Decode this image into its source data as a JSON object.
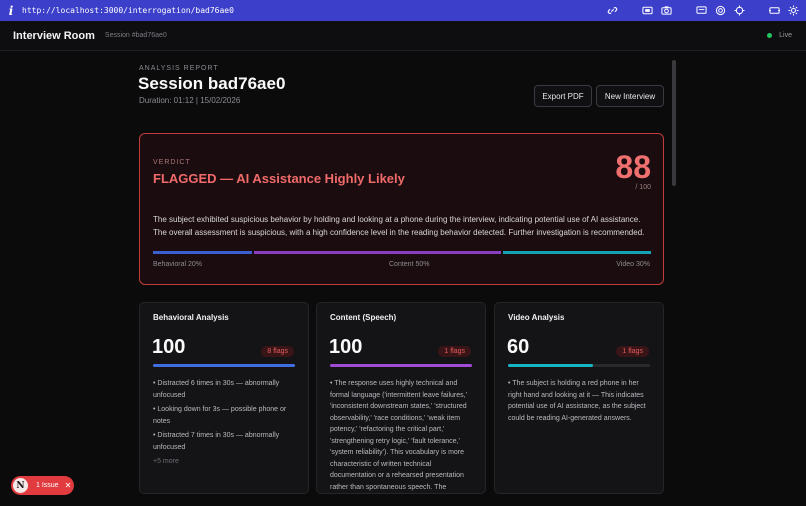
{
  "browser": {
    "url": "http://localhost:3000/interrogation/bad76ae0",
    "icons": [
      "info-icon",
      "link-icon",
      "screenshot-icon",
      "camera-icon",
      "monitor-icon",
      "target-icon",
      "crosshair-icon",
      "expand-icon",
      "settings-icon"
    ]
  },
  "header": {
    "title": "Interview Room",
    "session": "Session #bad76ae0",
    "status": "Live",
    "status_color": "#22c55e"
  },
  "report": {
    "kicker": "ANALYSIS REPORT",
    "title": "Session bad76ae0",
    "meta": "Duration: 01:12 | 15/02/2026",
    "export_label": "Export PDF",
    "new_label": "New Interview"
  },
  "verdict": {
    "label": "VERDICT",
    "title": "FLAGGED — AI Assistance Highly Likely",
    "score": "88",
    "score_max": "/ 100",
    "summary": "The subject exhibited suspicious behavior by holding and looking at a phone during the interview, indicating potential use of AI assistance. The overall assessment is suspicious, with a high confidence level in the reading behavior detected. Further investigation is recommended.",
    "weights": [
      {
        "label": "Behavioral 20%",
        "value": 20,
        "color": "#3c5fd0"
      },
      {
        "label": "Content 50%",
        "value": 50,
        "color": "#8a3fc2"
      },
      {
        "label": "Video 30%",
        "value": 30,
        "color": "#14a3b3"
      }
    ],
    "accent": "#c23c3c"
  },
  "cards": [
    {
      "title": "Behavioral Analysis",
      "score": "100",
      "flags": "8 flags",
      "meter": 1.0,
      "notes": [
        "• Distracted 6 times in 30s — abnormally unfocused",
        "• Looking down for 3s — possible phone or notes",
        "• Distracted 7 times in 30s — abnormally unfocused"
      ],
      "more": "+5 more"
    },
    {
      "title": "Content (Speech)",
      "score": "100",
      "flags": "1 flags",
      "meter": 1.0,
      "notes": [
        "• The response uses highly technical and formal language ('intermittent leave failures,' 'inconsistent downstream states,' 'structured observability,' 'race conditions,' 'weak item potency,' 'refactoring the critical part,' 'strengthening retry logic,' 'fault tolerance,' 'system reliability'). This vocabulary is more characteristic of written technical documentation or a rehearsed presentation rather than spontaneous speech. The sentence structure is also very precise and lacks the"
      ]
    },
    {
      "title": "Video Analysis",
      "score": "60",
      "flags": "1 flags",
      "meter": 0.6,
      "notes": [
        "• The subject is holding a red phone in her right hand and looking at it — This indicates potential use of AI assistance, as the subject could be reading AI-generated answers."
      ]
    }
  ],
  "issue": {
    "logo": "N",
    "label": "1 Issue",
    "close": "✕"
  }
}
